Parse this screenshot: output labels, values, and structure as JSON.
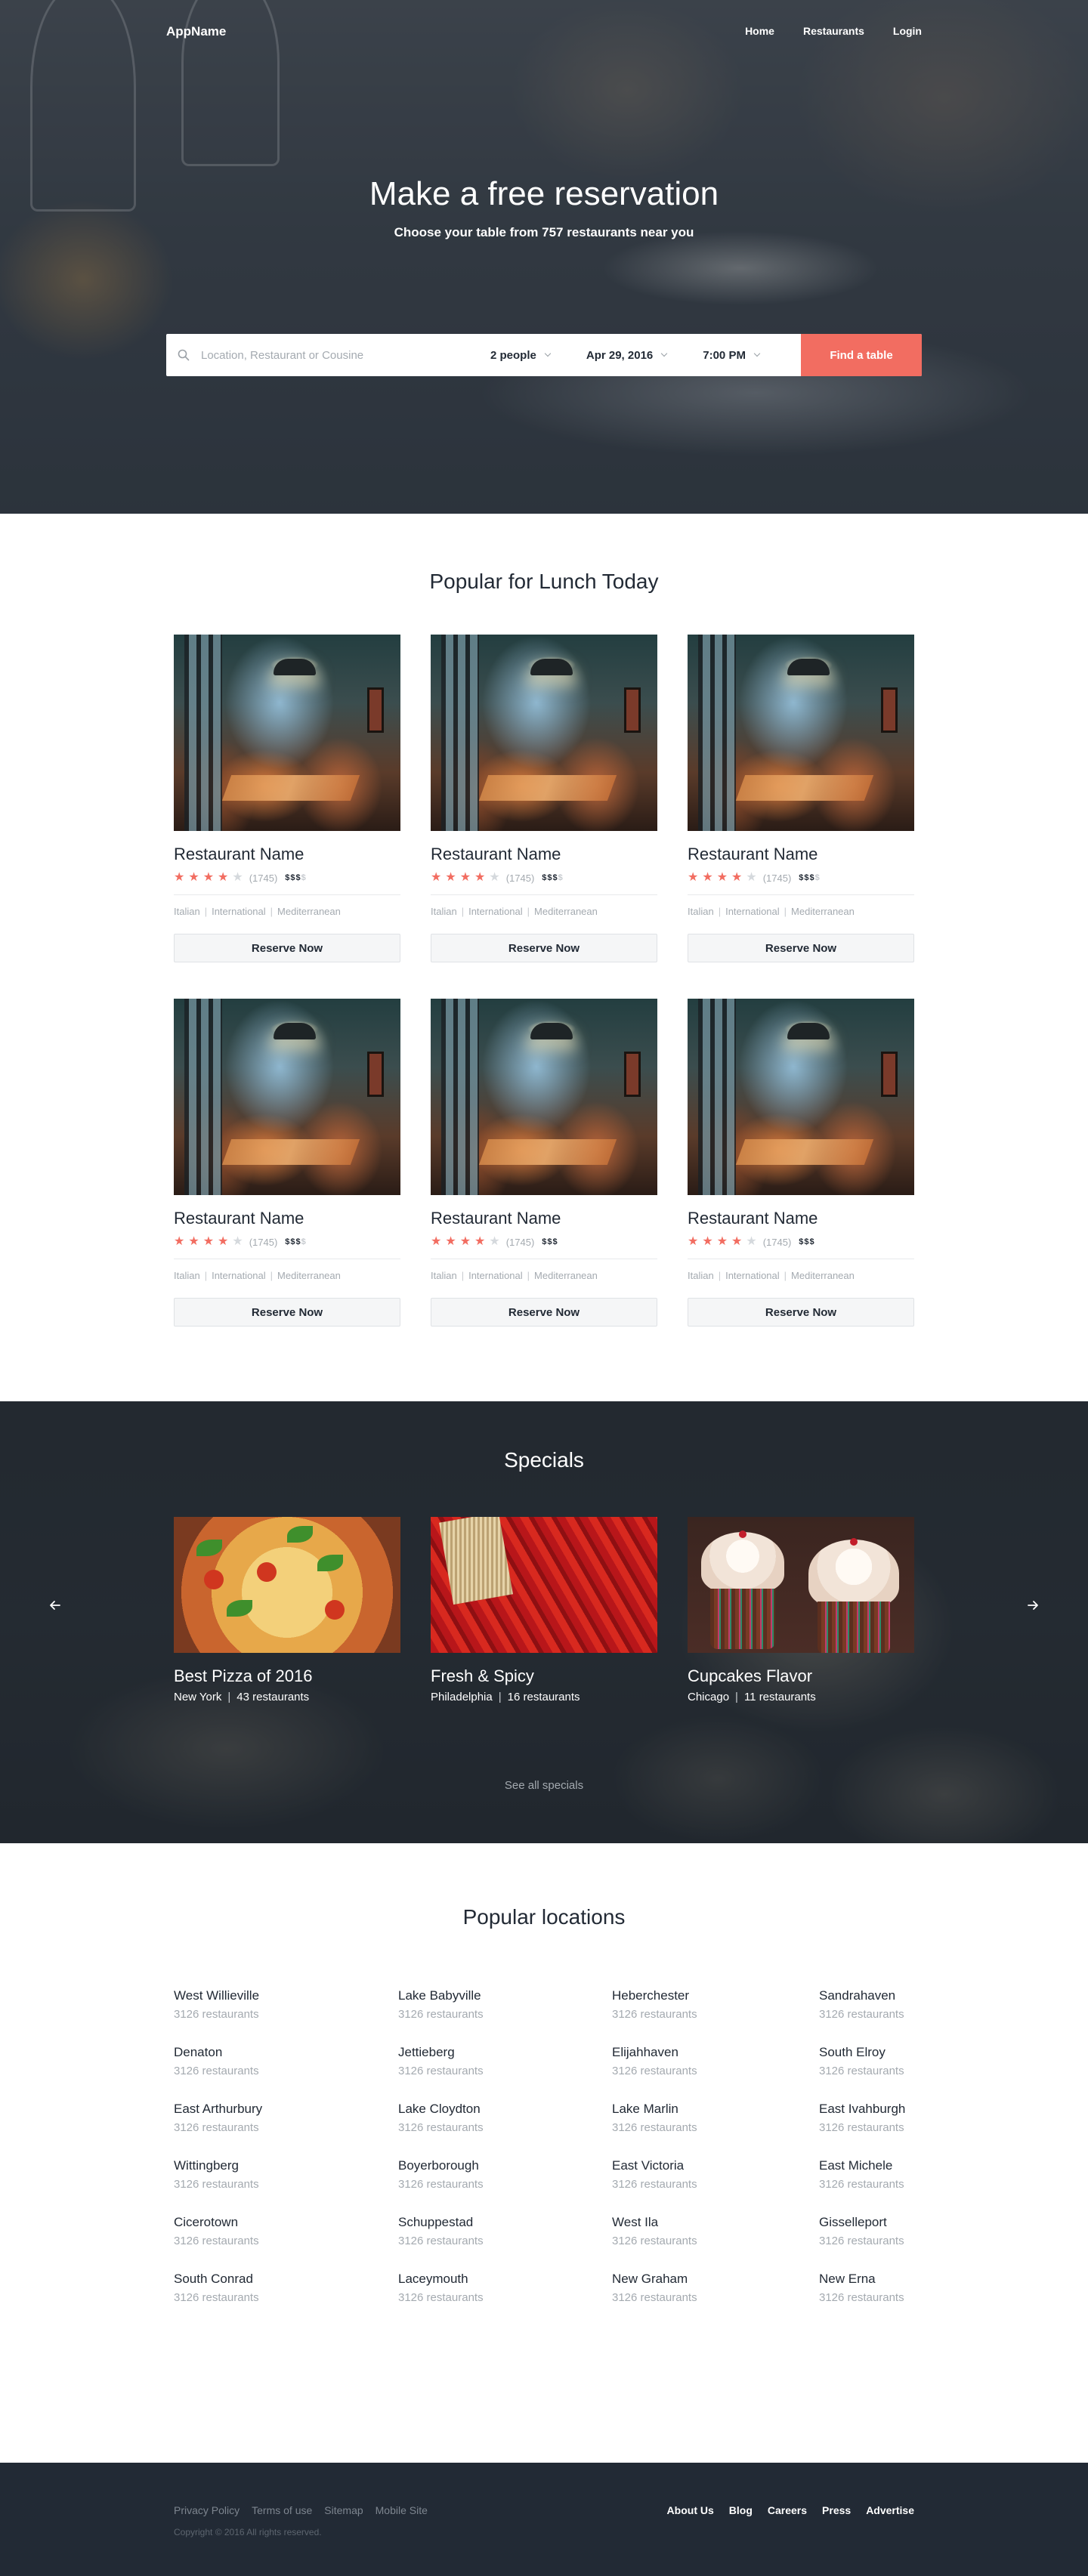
{
  "header": {
    "logo": "AppName",
    "nav": [
      "Home",
      "Restaurants",
      "Login"
    ]
  },
  "hero": {
    "title": "Make a free reservation",
    "subtitle": "Choose your table from 757 restaurants near you"
  },
  "search": {
    "placeholder": "Location, Restaurant or Cousine",
    "value": "",
    "people": "2 people",
    "date": "Apr 29, 2016",
    "time": "7:00 PM",
    "button": "Find a table",
    "icon": "search-icon"
  },
  "popular": {
    "title": "Popular for Lunch Today",
    "cards": [
      {
        "name": "Restaurant Name",
        "rating": 4,
        "reviews": "(1745)",
        "price": "$$$",
        "price_dim": "$",
        "cuisines": [
          "Italian",
          "International",
          "Mediterranean"
        ],
        "button": "Reserve Now"
      },
      {
        "name": "Restaurant Name",
        "rating": 4,
        "reviews": "(1745)",
        "price": "$$$",
        "price_dim": "$",
        "cuisines": [
          "Italian",
          "International",
          "Mediterranean"
        ],
        "button": "Reserve Now"
      },
      {
        "name": "Restaurant Name",
        "rating": 4,
        "reviews": "(1745)",
        "price": "$$$",
        "price_dim": "$",
        "cuisines": [
          "Italian",
          "International",
          "Mediterranean"
        ],
        "button": "Reserve Now"
      },
      {
        "name": "Restaurant Name",
        "rating": 4,
        "reviews": "(1745)",
        "price": "$$$",
        "price_dim": "$",
        "cuisines": [
          "Italian",
          "International",
          "Mediterranean"
        ],
        "button": "Reserve Now"
      },
      {
        "name": "Restaurant Name",
        "rating": 4,
        "reviews": "(1745)",
        "price": "$$$",
        "price_dim": "",
        "cuisines": [
          "Italian",
          "International",
          "Mediterranean"
        ],
        "button": "Reserve Now"
      },
      {
        "name": "Restaurant Name",
        "rating": 4,
        "reviews": "(1745)",
        "price": "$$$",
        "price_dim": "",
        "cuisines": [
          "Italian",
          "International",
          "Mediterranean"
        ],
        "button": "Reserve Now"
      }
    ]
  },
  "specials": {
    "title": "Specials",
    "items": [
      {
        "title": "Best Pizza of 2016",
        "city": "New York",
        "count": "43 restaurants"
      },
      {
        "title": "Fresh & Spicy",
        "city": "Philadelphia",
        "count": "16 restaurants"
      },
      {
        "title": "Cupcakes Flavor",
        "city": "Chicago",
        "count": "11 restaurants"
      }
    ],
    "see_all": "See all specials",
    "prev_icon": "arrow-left-icon",
    "next_icon": "arrow-right-icon"
  },
  "locations": {
    "title": "Popular locations",
    "columns": [
      [
        {
          "name": "West Willieville",
          "count": "3126 restaurants"
        },
        {
          "name": "Denaton",
          "count": "3126 restaurants"
        },
        {
          "name": "East Arthurbury",
          "count": "3126 restaurants"
        },
        {
          "name": "Wittingberg",
          "count": "3126 restaurants"
        },
        {
          "name": "Cicerotown",
          "count": "3126 restaurants"
        },
        {
          "name": "South Conrad",
          "count": "3126 restaurants"
        }
      ],
      [
        {
          "name": "Lake Babyville",
          "count": "3126 restaurants"
        },
        {
          "name": "Jettieberg",
          "count": "3126 restaurants"
        },
        {
          "name": "Lake Cloydton",
          "count": "3126 restaurants"
        },
        {
          "name": "Boyerborough",
          "count": "3126 restaurants"
        },
        {
          "name": "Schuppestad",
          "count": "3126 restaurants"
        },
        {
          "name": "Laceymouth",
          "count": "3126 restaurants"
        }
      ],
      [
        {
          "name": "Heberchester",
          "count": "3126 restaurants"
        },
        {
          "name": "Elijahhaven",
          "count": "3126 restaurants"
        },
        {
          "name": "Lake Marlin",
          "count": "3126 restaurants"
        },
        {
          "name": "East Victoria",
          "count": "3126 restaurants"
        },
        {
          "name": "West Ila",
          "count": "3126 restaurants"
        },
        {
          "name": "New Graham",
          "count": "3126 restaurants"
        }
      ],
      [
        {
          "name": "Sandrahaven",
          "count": "3126 restaurants"
        },
        {
          "name": "South Elroy",
          "count": "3126 restaurants"
        },
        {
          "name": "East Ivahburgh",
          "count": "3126 restaurants"
        },
        {
          "name": "East Michele",
          "count": "3126 restaurants"
        },
        {
          "name": "Gisselleport",
          "count": "3126 restaurants"
        },
        {
          "name": "New Erna",
          "count": "3126 restaurants"
        }
      ]
    ]
  },
  "footer": {
    "left_links": [
      "Privacy Policy",
      "Terms of use",
      "Sitemap",
      "Mobile Site"
    ],
    "copyright": "Copyright © 2016 All rights reserved.",
    "right_links": [
      "About Us",
      "Blog",
      "Careers",
      "Press",
      "Advertise"
    ]
  },
  "colors": {
    "accent": "#f26d61",
    "dark": "#222a35",
    "muted": "#a4aab0"
  }
}
